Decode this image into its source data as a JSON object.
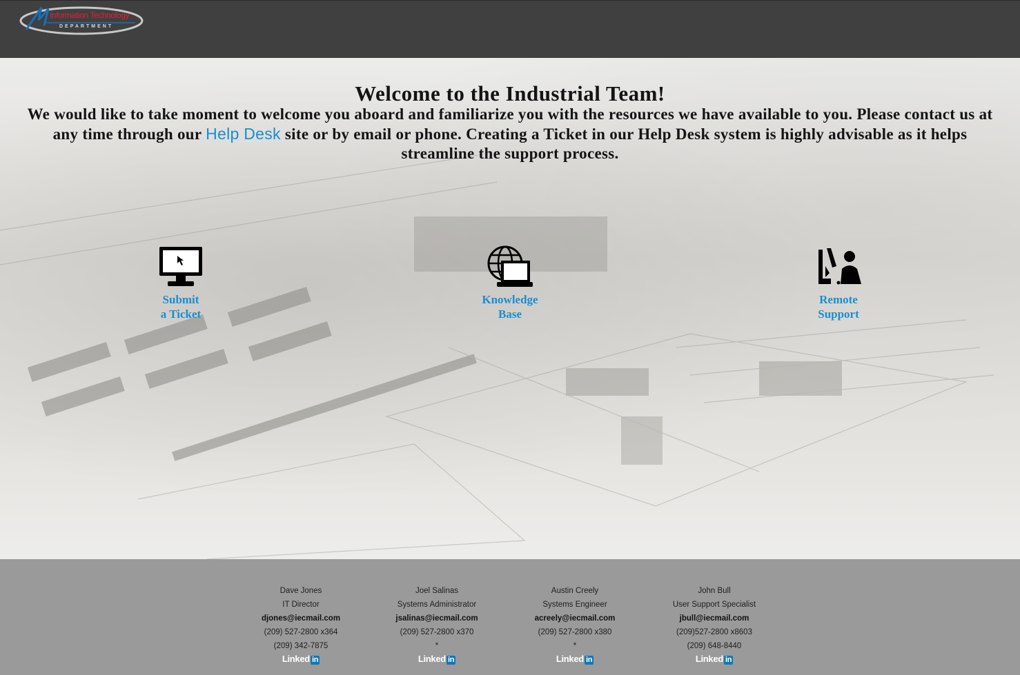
{
  "header": {
    "logo_top": "Information Technology",
    "logo_bottom": "DEPARTMENT"
  },
  "welcome": {
    "title": "Welcome to the Industrial Team!",
    "body_before_link": "We would like to take moment to welcome you aboard and familiarize you with the resources we have available to you. Please contact us at any time through our",
    "link_text": "Help Desk",
    "body_after_link": "site or by email or phone. Creating a Ticket in our Help Desk system is highly advisable as it helps streamline the support process."
  },
  "services": [
    {
      "line1": "Submit",
      "line2": "a Ticket",
      "icon": "monitor-icon"
    },
    {
      "line1": "Knowledge",
      "line2": "Base",
      "icon": "globe-laptop-icon"
    },
    {
      "line1": "Remote",
      "line2": "Support",
      "icon": "remote-support-icon"
    }
  ],
  "contacts": [
    {
      "name": "Dave Jones",
      "title": "IT Director",
      "email": "djones@iecmail.com",
      "phone1": "(209) 527-2800 x364",
      "phone2": "(209) 342-7875",
      "linkedin": "Linked",
      "in": "in"
    },
    {
      "name": "Joel Salinas",
      "title": "Systems Administrator",
      "email": "jsalinas@iecmail.com",
      "phone1": "(209) 527-2800 x370",
      "phone2": "*",
      "linkedin": "Linked",
      "in": "in"
    },
    {
      "name": "Austin Creely",
      "title": "Systems Engineer",
      "email": "acreely@iecmail.com",
      "phone1": "(209) 527-2800 x380",
      "phone2": "*",
      "linkedin": "Linked",
      "in": "in"
    },
    {
      "name": "John Bull",
      "title": "User Support Specialist",
      "email": "jbull@iecmail.com",
      "phone1": "(209)527-2800 x8603",
      "phone2": "(209) 648-8440",
      "linkedin": "Linked",
      "in": "in"
    }
  ],
  "colors": {
    "header_bg": "#404040",
    "link_blue": "#1a8ed0",
    "footer_bg": "#9a9a9a"
  }
}
